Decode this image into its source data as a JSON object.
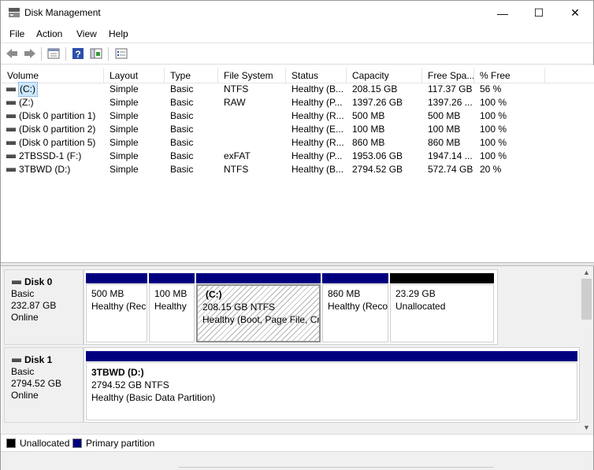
{
  "window": {
    "title": "Disk Management"
  },
  "titlebar": {
    "minimize": "—",
    "maximize": "☐",
    "close": "✕"
  },
  "menu": [
    "File",
    "Action",
    "View",
    "Help"
  ],
  "toolbar": {
    "icons": [
      "back-icon",
      "forward-icon",
      "properties-icon",
      "help-icon",
      "console-tree-icon",
      "checklist-icon"
    ]
  },
  "volume_list": {
    "columns": [
      "Volume",
      "Layout",
      "Type",
      "File System",
      "Status",
      "Capacity",
      "Free Spa...",
      "% Free"
    ],
    "rows": [
      {
        "volume": " (C:)",
        "layout": "Simple",
        "type": "Basic",
        "fs": "NTFS",
        "status": "Healthy (B...",
        "capacity": "208.15 GB",
        "free": "117.37 GB",
        "pct": "56 %",
        "selected": true
      },
      {
        "volume": " (Z:)",
        "layout": "Simple",
        "type": "Basic",
        "fs": "RAW",
        "status": "Healthy (P...",
        "capacity": "1397.26 GB",
        "free": "1397.26 ...",
        "pct": "100 %"
      },
      {
        "volume": "(Disk 0 partition 1)",
        "layout": "Simple",
        "type": "Basic",
        "fs": "",
        "status": "Healthy (R...",
        "capacity": "500 MB",
        "free": "500 MB",
        "pct": "100 %"
      },
      {
        "volume": "(Disk 0 partition 2)",
        "layout": "Simple",
        "type": "Basic",
        "fs": "",
        "status": "Healthy (E...",
        "capacity": "100 MB",
        "free": "100 MB",
        "pct": "100 %"
      },
      {
        "volume": "(Disk 0 partition 5)",
        "layout": "Simple",
        "type": "Basic",
        "fs": "",
        "status": "Healthy (R...",
        "capacity": "860 MB",
        "free": "860 MB",
        "pct": "100 %"
      },
      {
        "volume": "2TBSSD-1 (F:)",
        "layout": "Simple",
        "type": "Basic",
        "fs": "exFAT",
        "status": "Healthy (P...",
        "capacity": "1953.06 GB",
        "free": "1947.14 ...",
        "pct": "100 %"
      },
      {
        "volume": "3TBWD (D:)",
        "layout": "Simple",
        "type": "Basic",
        "fs": "NTFS",
        "status": "Healthy (B...",
        "capacity": "2794.52 GB",
        "free": "572.74 GB",
        "pct": "20 %"
      }
    ]
  },
  "disks": [
    {
      "name": "Disk 0",
      "type": "Basic",
      "size": "232.87 GB",
      "state": "Online",
      "partitions": [
        {
          "line1": "",
          "line2": "500 MB",
          "line3": "Healthy (Rec",
          "color": "#00007f"
        },
        {
          "line1": "",
          "line2": "100 MB",
          "line3": "Healthy",
          "color": "#00007f"
        },
        {
          "line1": "(C:)",
          "line2": "208.15 GB NTFS",
          "line3": "Healthy (Boot, Page File, Cr",
          "color": "#00007f",
          "selected": true
        },
        {
          "line1": "",
          "line2": "860 MB",
          "line3": "Healthy (Reco",
          "color": "#00007f"
        },
        {
          "line1": "",
          "line2": "23.29 GB",
          "line3": "Unallocated",
          "color": "#000000"
        }
      ]
    },
    {
      "name": "Disk 1",
      "type": "Basic",
      "size": "2794.52 GB",
      "state": "Online",
      "partitions": [
        {
          "line1": "3TBWD  (D:)",
          "line2": "2794.52 GB NTFS",
          "line3": "Healthy (Basic Data Partition)",
          "color": "#00007f"
        }
      ]
    }
  ],
  "legend": [
    {
      "label": "Unallocated",
      "color": "#000000"
    },
    {
      "label": "Primary partition",
      "color": "#00007f"
    }
  ],
  "scrollbar": {
    "up": "▲",
    "down": "▼"
  }
}
